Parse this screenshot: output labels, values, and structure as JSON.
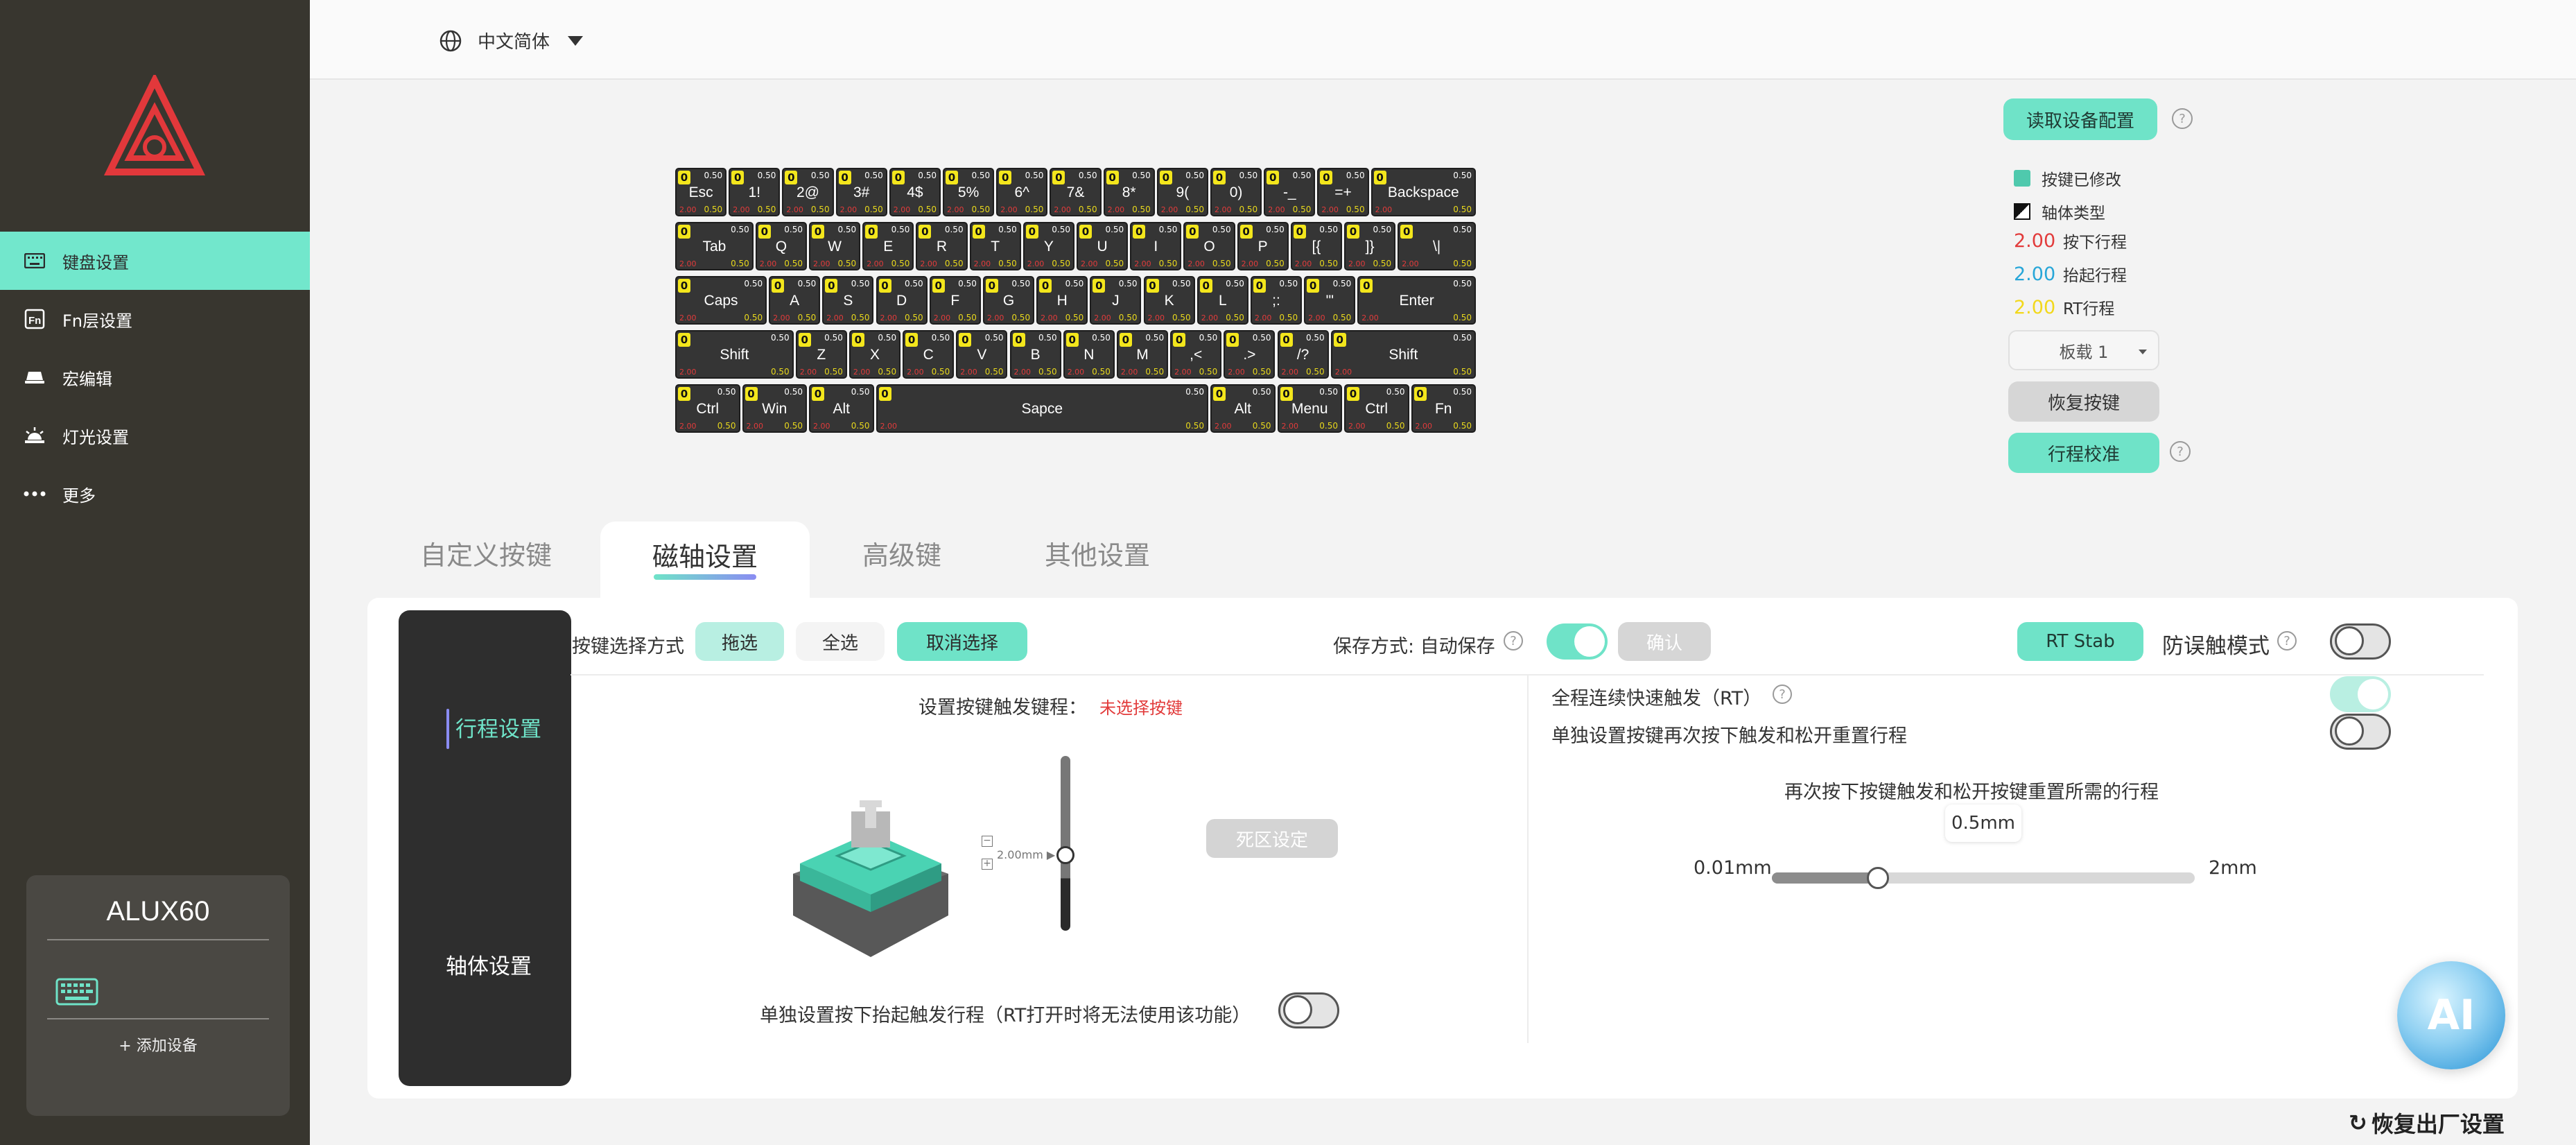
{
  "sidebar": {
    "items": [
      {
        "label": "键盘设置",
        "icon": "keyboard-icon",
        "active": true
      },
      {
        "label": "Fn层设置",
        "icon": "fn-icon",
        "active": false
      },
      {
        "label": "宏编辑",
        "icon": "macro-icon",
        "active": false
      },
      {
        "label": "灯光设置",
        "icon": "light-icon",
        "active": false
      },
      {
        "label": "更多",
        "icon": "more-icon",
        "active": false
      }
    ],
    "device": {
      "name": "ALUX60",
      "add_label": "+ 添加设备"
    }
  },
  "topbar": {
    "language": "中文简体"
  },
  "keyboard": {
    "badge": "0",
    "top_value": "0.50",
    "bottom_left": "2.00",
    "bottom_right": "0.50",
    "rows": [
      [
        "Esc",
        "1!",
        "2@",
        "3#",
        "4$",
        "5%",
        "6^",
        "7&",
        "8*",
        "9(",
        "0)",
        "-_",
        "=+",
        "Backspace"
      ],
      [
        "Tab",
        "Q",
        "W",
        "E",
        "R",
        "T",
        "Y",
        "U",
        "I",
        "O",
        "P",
        "[{",
        "]}",
        "\\|"
      ],
      [
        "Caps",
        "A",
        "S",
        "D",
        "F",
        "G",
        "H",
        "J",
        "K",
        "L",
        ";:",
        "'\"",
        "Enter"
      ],
      [
        "Shift",
        "Z",
        "X",
        "C",
        "V",
        "B",
        "N",
        "M",
        ",<",
        ".>",
        "/?",
        "Shift"
      ],
      [
        "Ctrl",
        "Win",
        "Alt",
        "Sapce",
        "Alt",
        "Menu",
        "Ctrl",
        "Fn"
      ]
    ]
  },
  "legend": {
    "read_config": "读取设备配置",
    "modified": "按键已修改",
    "axis_type": "轴体类型",
    "press_value": "2.00",
    "press_label": "按下行程",
    "lift_value": "2.00",
    "lift_label": "抬起行程",
    "rt_value": "2.00",
    "rt_label": "RT行程",
    "board": "板载 1",
    "restore_key": "恢复按键",
    "calibrate": "行程校准",
    "colors": {
      "modified": "#4fc9ad",
      "press": "#e23b3b",
      "lift": "#27a6d8",
      "rt": "#f2d81c"
    }
  },
  "tabs": [
    "自定义按键",
    "磁轴设置",
    "高级键",
    "其他设置"
  ],
  "subnav": {
    "travel": "行程设置",
    "axis": "轴体设置"
  },
  "controls": {
    "select_mode_label": "按键选择方式",
    "drag": "拖选",
    "select_all": "全选",
    "cancel_select": "取消选择",
    "save_mode": "保存方式: 自动保存",
    "confirm": "确认",
    "rt_stab": "RT Stab",
    "anti_mistouch": "防误触模式",
    "set_trigger_label": "设置按键触发键程：",
    "no_key_selected": "未选择按键",
    "travel_indicator": "2.00mm ▶",
    "deadzone": "死区设定",
    "rt_lift_note": "单独设置按下抬起触发行程（RT打开时将无法使用该功能）",
    "full_rt": "全程连续快速触发（RT）",
    "separate_repress": "单独设置按键再次按下触发和松开重置行程",
    "repress_title": "再次按下按键触发和松开按键重置所需的行程",
    "repress_value": "0.5mm",
    "min_label": "0.01mm",
    "max_label": "2mm",
    "slider_fraction": 0.25
  },
  "ai_label": "AI",
  "factory_reset": "恢复出厂设置"
}
